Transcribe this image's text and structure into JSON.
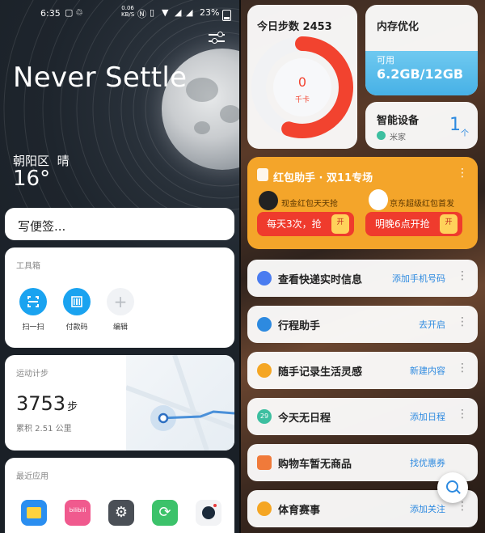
{
  "status_bar": {
    "time": "6:35",
    "network_speed": "0.06",
    "network_unit": "KB/S",
    "battery": "23%"
  },
  "home": {
    "title": "Never Settle",
    "weather": {
      "location": "朝阳区",
      "condition": "晴",
      "temperature": "16°"
    },
    "note_placeholder": "写便签...",
    "toolbox": {
      "title": "工具箱",
      "items": [
        {
          "label": "扫一扫",
          "icon": "scan-icon",
          "color": "#1aa3f0"
        },
        {
          "label": "付款码",
          "icon": "barcode-icon",
          "color": "#1aa3f0"
        },
        {
          "label": "编辑",
          "icon": "plus-icon",
          "color": "#f0f2f5"
        }
      ]
    },
    "steps": {
      "title": "运动计步",
      "count": "3753",
      "unit": "步",
      "distance": "累积 2.51 公里"
    },
    "recent_apps": {
      "title": "最近应用",
      "apps": [
        {
          "name": "gallery-app",
          "color": "#2a8ef0"
        },
        {
          "name": "bilibili-app",
          "text": "bilibili",
          "color": "#f05a8e"
        },
        {
          "name": "settings-app",
          "color": "#4a4f56"
        },
        {
          "name": "sync-app",
          "color": "#3cc26a"
        },
        {
          "name": "camera-app",
          "color": "#f2f3f5"
        }
      ]
    }
  },
  "assistant": {
    "steps_card": {
      "title": "今日步数 2453",
      "calories": "0",
      "calories_unit": "千卡",
      "progress_fraction": 0.55,
      "accent": "#f2432f"
    },
    "memory_card": {
      "title": "内存优化",
      "available_label": "可用",
      "available_value": "6.2GB/12GB"
    },
    "devices_card": {
      "title": "智能设备",
      "source": "米家",
      "count": "1",
      "count_unit": "个"
    },
    "red_packet": {
      "title": "红包助手 · 双11专场",
      "left": {
        "subtitle": "现金红包天天抢",
        "button": "每天3次，抢"
      },
      "right": {
        "subtitle": "京东超级红包首发",
        "button": "明晚6点开抢"
      },
      "coin_label": "开"
    },
    "rows": [
      {
        "title": "查看快递实时信息",
        "action": "添加手机号码",
        "icon": "package-icon",
        "color": "#4a7cf0"
      },
      {
        "title": "行程助手",
        "action": "去开启",
        "icon": "plane-icon",
        "color": "#2d8ae0"
      },
      {
        "title": "随手记录生活灵感",
        "action": "新建内容",
        "icon": "pencil-icon",
        "color": "#f5a623"
      },
      {
        "title": "今天无日程",
        "action": "添加日程",
        "icon": "calendar-icon",
        "color": "#3dbfa0",
        "icon_text": "29"
      },
      {
        "title": "购物车暂无商品",
        "action": "找优惠券",
        "icon": "cart-icon",
        "color": "#f07a3a"
      },
      {
        "title": "体育赛事",
        "action": "添加关注",
        "icon": "trophy-icon",
        "color": "#f5a623"
      }
    ],
    "more_glyph": "⋮"
  }
}
